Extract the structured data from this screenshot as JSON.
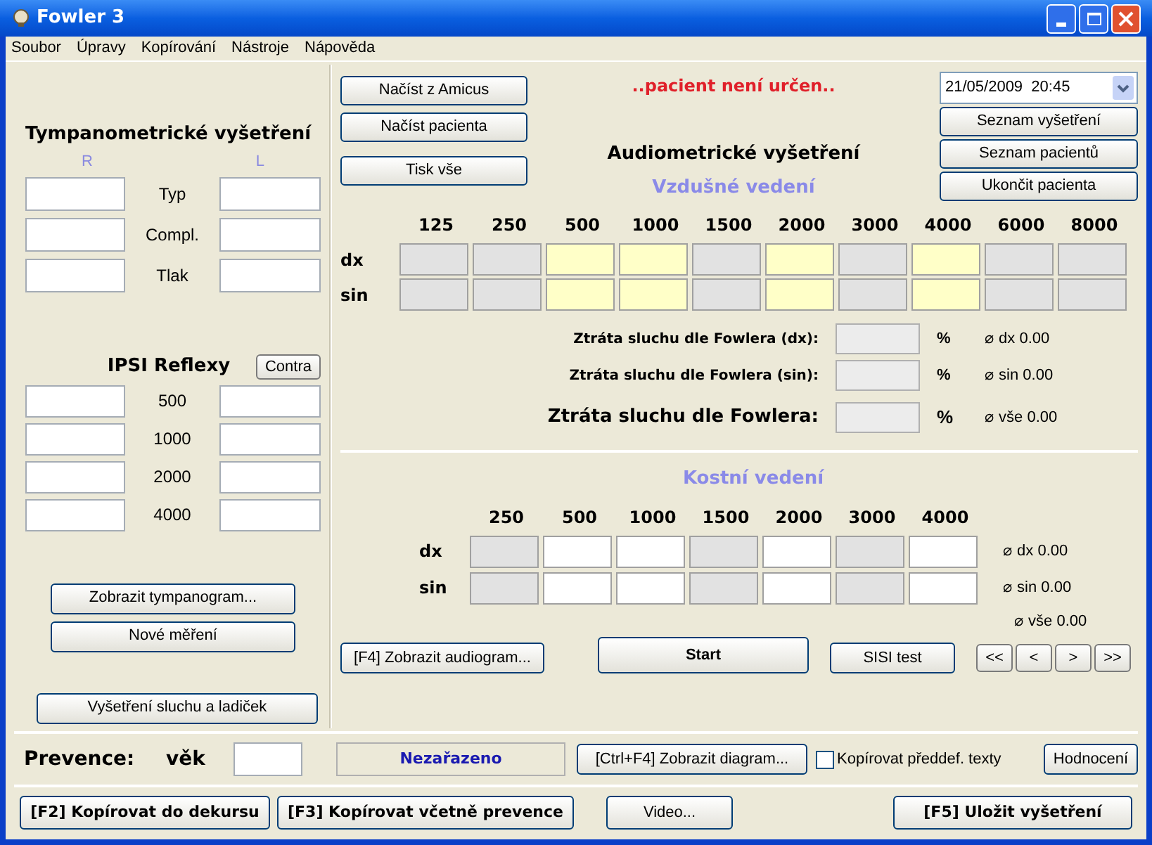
{
  "window": {
    "title": "Fowler 3"
  },
  "menu": [
    "Soubor",
    "Úpravy",
    "Kopírování",
    "Nástroje",
    "Nápověda"
  ],
  "tympanometry": {
    "title": "Tympanometrické vyšetření",
    "columns": [
      "R",
      "L"
    ],
    "rows": [
      "Typ",
      "Compl.",
      "Tlak"
    ]
  },
  "ipsi": {
    "title": "IPSI Reflexy",
    "contra_button": "Contra",
    "rows": [
      "500",
      "1000",
      "2000",
      "4000"
    ]
  },
  "left_buttons": [
    "Zobrazit tympanogram...",
    "Nové měření"
  ],
  "exam_button": "Vyšetření sluchu a ladiček",
  "load_buttons": [
    "Načíst z Amicus",
    "Načíst pacienta",
    "Tisk vše"
  ],
  "patient_status": "..pacient není určen..",
  "date": "21/05/2009  20:45",
  "list_buttons": [
    "Seznam vyšetření",
    "Seznam pacientů",
    "Ukončit pacienta"
  ],
  "audiometry": {
    "title": "Audiometrické vyšetření",
    "air": {
      "title": "Vzdušné vedení",
      "rows": [
        "dx",
        "sin"
      ],
      "columns": [
        {
          "label": "125",
          "enabled": false
        },
        {
          "label": "250",
          "enabled": false
        },
        {
          "label": "500",
          "enabled": true
        },
        {
          "label": "1000",
          "enabled": true
        },
        {
          "label": "1500",
          "enabled": false
        },
        {
          "label": "2000",
          "enabled": true
        },
        {
          "label": "3000",
          "enabled": false
        },
        {
          "label": "4000",
          "enabled": true
        },
        {
          "label": "6000",
          "enabled": false
        },
        {
          "label": "8000",
          "enabled": false
        }
      ]
    },
    "loss": [
      {
        "kind": "side",
        "label": "Ztráta sluchu dle Fowlera (dx):",
        "unit": "%",
        "average": "⌀ dx 0.00"
      },
      {
        "kind": "side",
        "label": "Ztráta sluchu dle Fowlera (sin):",
        "unit": "%",
        "average": "⌀ sin 0.00"
      },
      {
        "kind": "total",
        "label": "Ztráta sluchu dle Fowlera:",
        "unit": "%",
        "average": "⌀ vše 0.00"
      }
    ],
    "bone": {
      "title": "Kostní vedení",
      "rows": [
        "dx",
        "sin"
      ],
      "averages": [
        "⌀ dx 0.00",
        "⌀ sin 0.00"
      ],
      "total_average": "⌀ vše 0.00",
      "columns": [
        {
          "label": "250",
          "enabled": false
        },
        {
          "label": "500",
          "enabled": true
        },
        {
          "label": "1000",
          "enabled": true
        },
        {
          "label": "1500",
          "enabled": false
        },
        {
          "label": "2000",
          "enabled": true
        },
        {
          "label": "3000",
          "enabled": false
        },
        {
          "label": "4000",
          "enabled": true
        }
      ]
    }
  },
  "actions": {
    "audiogram_button": "[F4] Zobrazit audiogram...",
    "start_button": "Start",
    "sisi_button": "SISI test",
    "nav": [
      "<<",
      "<",
      ">",
      ">>"
    ]
  },
  "prevence": {
    "label": "Prevence:",
    "age_label": "věk",
    "category": "Nezařazeno",
    "diagram_button": "[Ctrl+F4] Zobrazit diagram...",
    "copy_texts": {
      "label": "Kopírovat předdef. texty",
      "checked": false
    },
    "evaluation_button": "Hodnocení"
  },
  "bottom_buttons": [
    {
      "label": "[F2] Kopírovat do dekursu",
      "bold": true
    },
    {
      "label": "[F3] Kopírovat včetně prevence",
      "bold": true
    },
    {
      "label": "Video...",
      "bold": false
    },
    {
      "label": "[F5] Uložit vyšetření",
      "bold": true
    }
  ]
}
